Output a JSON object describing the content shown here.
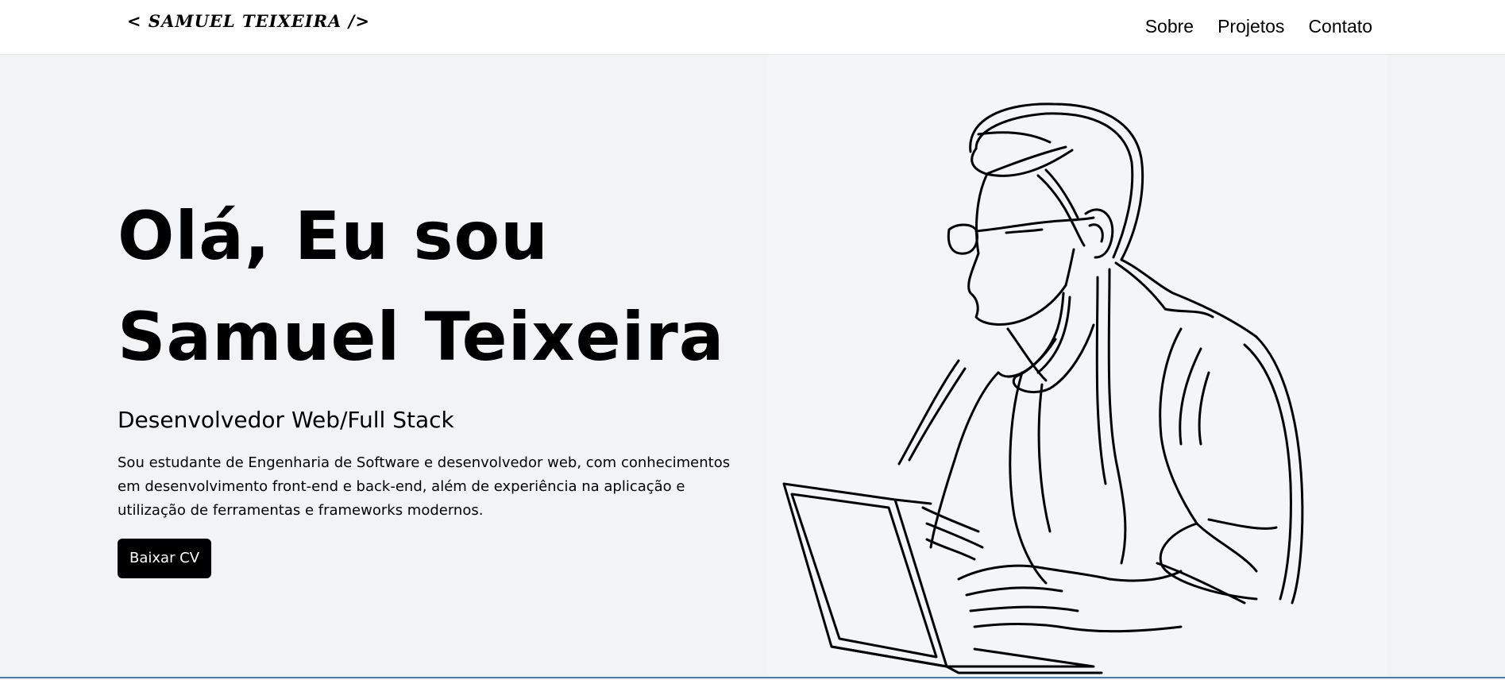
{
  "navbar": {
    "logo": "< SAMUEL TEIXEIRA />",
    "links": [
      "Sobre",
      "Projetos",
      "Contato"
    ]
  },
  "hero": {
    "headline_line1": "Olá, Eu sou",
    "headline_line2": "Samuel Teixeira",
    "subtitle": "Desenvolvedor Web/Full Stack",
    "description": "Sou estudante de Engenharia de Software e desenvolvedor web, com conhecimentos em desenvolvimento front-end e back-end, além de experiência na aplicação e utilização de ferramentas e frameworks modernos.",
    "cv_button": "Baixar CV",
    "illustration": "line-art-developer-with-laptop"
  },
  "colors": {
    "background": "#f2f3f5",
    "navbar": "#ffffff",
    "button": "#000000",
    "button_text": "#ffffff",
    "accent_line": "#4a78c2"
  }
}
